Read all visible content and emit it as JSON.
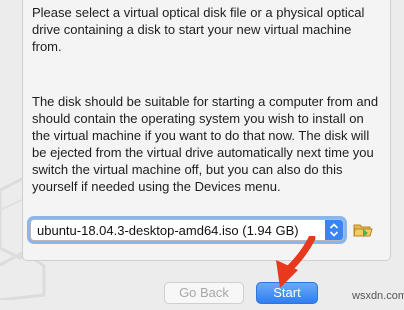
{
  "dialog": {
    "instructions": [
      "Please select a virtual optical disk file or a physical optical drive containing a disk to start your new virtual machine from.",
      "The disk should be suitable for starting a computer from and should contain the operating system you wish to install on the virtual machine if you want to do that now. The disk will be ejected from the virtual drive automatically next time you switch the virtual machine off, but you can also do this yourself if needed using the Devices menu."
    ],
    "disk_select": {
      "value": "ubuntu-18.04.3-desktop-amd64.iso (1.94 GB)",
      "arrow_icon": "up-down-chevron-icon"
    },
    "folder_icon": "folder-open-icon"
  },
  "buttons": {
    "back_label": "Go Back",
    "start_label": "Start"
  },
  "overlay": {
    "arrow_color": "#e8391e",
    "site_mark": "wsxdn.com"
  },
  "colors": {
    "accent": "#2f7ff2",
    "focus_ring": "#8ab6ef"
  }
}
